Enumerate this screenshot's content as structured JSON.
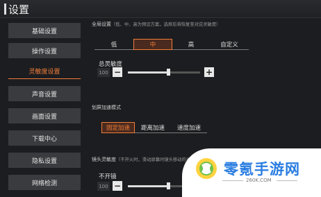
{
  "window": {
    "title": "设置"
  },
  "sidebar": {
    "items": [
      {
        "label": "基础设置",
        "active": false
      },
      {
        "label": "操作设置",
        "active": false
      },
      {
        "label": "灵敏度设置",
        "active": true
      },
      {
        "label": "声音设置",
        "active": false
      },
      {
        "label": "画面设置",
        "active": false
      },
      {
        "label": "下载中心",
        "active": false
      },
      {
        "label": "隐私设置",
        "active": false
      },
      {
        "label": "网络检测",
        "active": false
      }
    ]
  },
  "global_settings": {
    "title": "全局设置",
    "note": "（低、中、高为预设方案，选择后将恢复至对应灵敏度）",
    "options": [
      "低",
      "中",
      "高",
      "自定义"
    ],
    "selected": "中"
  },
  "total_sensitivity": {
    "label": "总灵敏度",
    "value": "100",
    "level_percent": 56
  },
  "swipe_accel": {
    "title": "划屏加速模式",
    "options": [
      "固定加速",
      "距离加速",
      "速度加速"
    ],
    "selected": "固定加速"
  },
  "camera_sensitivity": {
    "title": "镜头灵敏度",
    "note": "（不开火时，滑动屏幕时镜头移动的灵敏度）",
    "subitem_label": "不开镜",
    "value": "100",
    "level_percent": 56
  },
  "watermark": {
    "text": "零氪手游网",
    "url": "260K.COM"
  },
  "colors": {
    "accent": "#f07d3a",
    "background": "#1c1d20",
    "sidebar_item": "#3a3b3f"
  },
  "icons": {
    "minus": "−",
    "plus": "+"
  }
}
